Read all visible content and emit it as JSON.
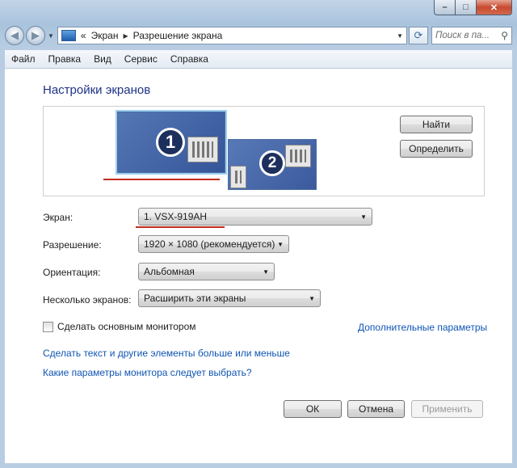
{
  "address": {
    "prefix": "«",
    "crumbs": [
      "Экран",
      "Разрешение экрана"
    ]
  },
  "search": {
    "placeholder": "Поиск в па..."
  },
  "menu": [
    "Файл",
    "Правка",
    "Вид",
    "Сервис",
    "Справка"
  ],
  "page": {
    "title": "Настройки экранов",
    "monitor_numbers": [
      "1",
      "2"
    ],
    "find_button": "Найти",
    "identify_button": "Определить"
  },
  "form": {
    "display_label": "Экран:",
    "display_value": "1. VSX-919AH",
    "resolution_label": "Разрешение:",
    "resolution_value": "1920 × 1080 (рекомендуется)",
    "orientation_label": "Ориентация:",
    "orientation_value": "Альбомная",
    "multiple_label": "Несколько экранов:",
    "multiple_value": "Расширить эти экраны",
    "primary_checkbox": "Сделать основным монитором",
    "advanced_link": "Дополнительные параметры"
  },
  "links": {
    "text_size": "Сделать текст и другие элементы больше или меньше",
    "which_settings": "Какие параметры монитора следует выбрать?"
  },
  "buttons": {
    "ok": "ОК",
    "cancel": "Отмена",
    "apply": "Применить"
  },
  "colors": {
    "annotation": "#c42b1c",
    "link": "#0f55b3",
    "title": "#1e3287"
  }
}
